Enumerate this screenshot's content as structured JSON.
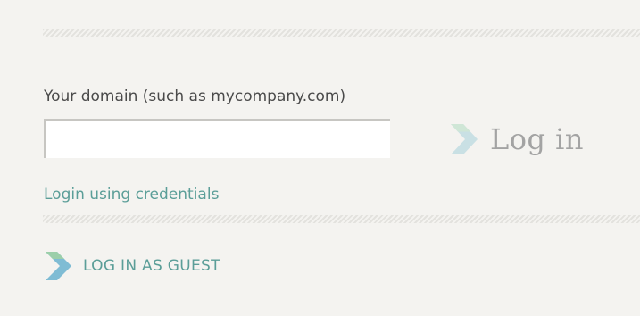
{
  "domain_field": {
    "label": "Your domain (such as mycompany.com)",
    "value": "",
    "placeholder": ""
  },
  "login_button": {
    "label": "Log in",
    "icon": "chevron-right-icon"
  },
  "credentials_link": {
    "label": "Login using credentials"
  },
  "guest_button": {
    "label": "LOG IN AS GUEST",
    "icon": "chevron-right-icon"
  },
  "colors": {
    "background": "#f4f3f0",
    "link": "#5b9e98",
    "login_text": "#a3a3a3",
    "label_text": "#4a4a4a"
  }
}
